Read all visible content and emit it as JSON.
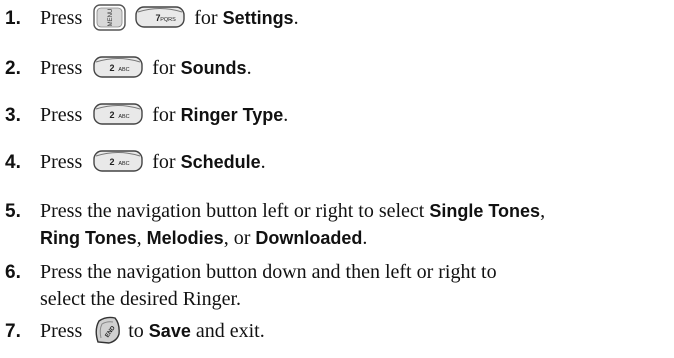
{
  "steps": [
    {
      "number": "1.",
      "press": "Press",
      "key1_icon": "menu-ok-key-icon",
      "key1_text": "MENU",
      "key2_icon": "7-pqrs-key-icon",
      "key2_text": "7PQRS",
      "for": "for",
      "target": "Settings",
      "end": "."
    },
    {
      "number": "2.",
      "press": "Press",
      "key_icon": "2-abc-key-icon",
      "key_text": "2ABC",
      "for": "for",
      "target": "Sounds",
      "end": "."
    },
    {
      "number": "3.",
      "press": "Press",
      "key_icon": "2-abc-key-icon",
      "key_text": "2ABC",
      "for": "for",
      "target": "Ringer Type",
      "end": "."
    },
    {
      "number": "4.",
      "press": "Press",
      "key_icon": "2-abc-key-icon",
      "key_text": "2ABC",
      "for": "for",
      "target": "Schedule",
      "end": "."
    },
    {
      "number": "5.",
      "text_a": "Press the navigation button left or right to select",
      "opt1": "Single Tones",
      "sep1": ",",
      "opt2": "Ring Tones",
      "sep2": ",",
      "opt3": "Melodies",
      "sep3": ", or",
      "opt4": "Downloaded",
      "end": "."
    },
    {
      "number": "6.",
      "line1": "Press the navigation button down and then left or right to",
      "line2": "select the desired Ringer."
    },
    {
      "number": "7.",
      "press": "Press",
      "key_icon": "end-key-icon",
      "key_text": "END",
      "to": "to",
      "target": "Save",
      "rest": "and exit."
    }
  ]
}
